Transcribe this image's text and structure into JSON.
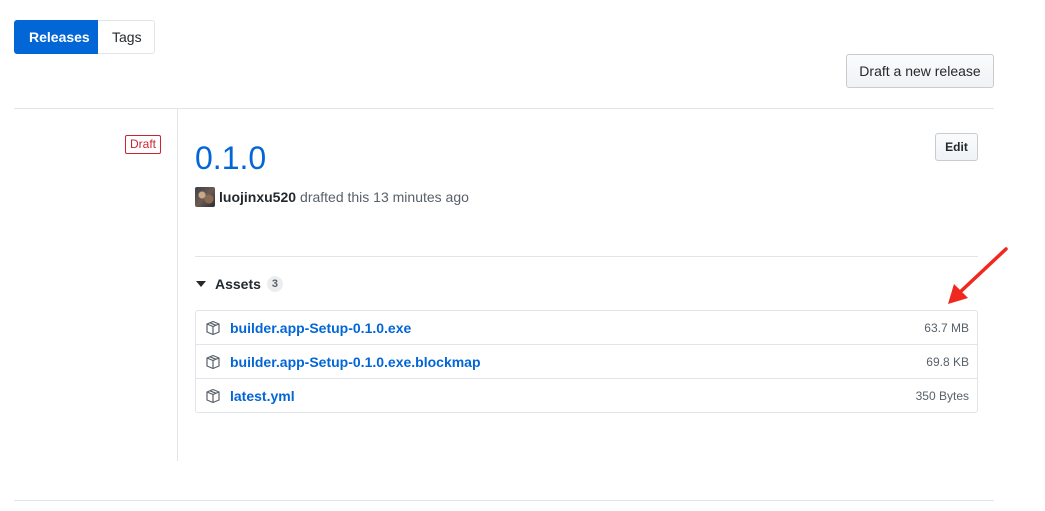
{
  "tabs": {
    "releases": "Releases",
    "tags": "Tags"
  },
  "actions": {
    "draft_new_release": "Draft a new release",
    "edit": "Edit"
  },
  "release": {
    "status_label": "Draft",
    "title": "0.1.0",
    "author": "luojinxu520",
    "action_text": "drafted this 13 minutes ago"
  },
  "assets": {
    "header": "Assets",
    "count": "3",
    "items": [
      {
        "name": "builder.app-Setup-0.1.0.exe",
        "size": "63.7 MB"
      },
      {
        "name": "builder.app-Setup-0.1.0.exe.blockmap",
        "size": "69.8 KB"
      },
      {
        "name": "latest.yml",
        "size": "350 Bytes"
      }
    ]
  },
  "colors": {
    "accent": "#0366d6",
    "draft": "#cb2431",
    "annotation_arrow": "#f0281e"
  },
  "icons": {
    "asset_icon": "package-icon",
    "caret": "triangle-down-icon"
  }
}
